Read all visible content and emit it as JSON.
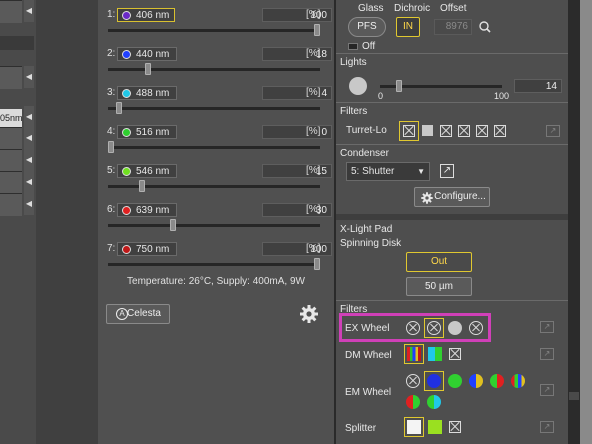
{
  "left_strip": {
    "cut_label": "05nm"
  },
  "laser": {
    "channels": [
      {
        "index": "1:",
        "name": "406 nm",
        "value": "100",
        "unit": "[%]",
        "color": "#6a28c8",
        "level": 1.0,
        "selected": true
      },
      {
        "index": "2:",
        "name": "440 nm",
        "value": "18",
        "unit": "[%]",
        "color": "#2040ff",
        "level": 0.18,
        "selected": false
      },
      {
        "index": "3:",
        "name": "488 nm",
        "value": "4",
        "unit": "[%]",
        "color": "#20c8e8",
        "level": 0.04,
        "selected": false
      },
      {
        "index": "4:",
        "name": "516 nm",
        "value": "0",
        "unit": "[%]",
        "color": "#30d030",
        "level": 0.0,
        "selected": false
      },
      {
        "index": "5:",
        "name": "546 nm",
        "value": "15",
        "unit": "[%]",
        "color": "#70e020",
        "level": 0.15,
        "selected": false
      },
      {
        "index": "6:",
        "name": "639 nm",
        "value": "30",
        "unit": "[%]",
        "color": "#e02020",
        "level": 0.3,
        "selected": false
      },
      {
        "index": "7:",
        "name": "750 nm",
        "value": "100",
        "unit": "[%]",
        "color": "#c01818",
        "level": 1.0,
        "selected": false
      }
    ],
    "status": "Temperature: 26°C, Supply: 400mA, 9W",
    "celesta_label": "Celesta",
    "celesta_icon": "A"
  },
  "right": {
    "glass_label": "Glass",
    "dichroic_label": "Dichroic",
    "offset_label": "Offset",
    "pfs_label": "PFS",
    "in_label": "IN",
    "offset_value": "8976",
    "off_label": "Off",
    "lights_label": "Lights",
    "lights_min": "0",
    "lights_max": "100",
    "lights_value": "14",
    "lights_level": 0.14,
    "filters_label": "Filters",
    "turret_label": "Turret-Lo",
    "condenser_label": "Condenser",
    "condenser_value": "5: Shutter",
    "configure_label": "Configure...",
    "xlight_label": "X-Light Pad",
    "spinning_label": "Spinning Disk",
    "out_label": "Out",
    "um_label": "50 µm",
    "filters2_label": "Filters",
    "ex_wheel_label": "EX Wheel",
    "dm_wheel_label": "DM Wheel",
    "em_wheel_label": "EM Wheel",
    "splitter_label": "Splitter"
  },
  "colors": {
    "selection_yellow": "#e0c830",
    "highlight_magenta": "#d040b8"
  }
}
